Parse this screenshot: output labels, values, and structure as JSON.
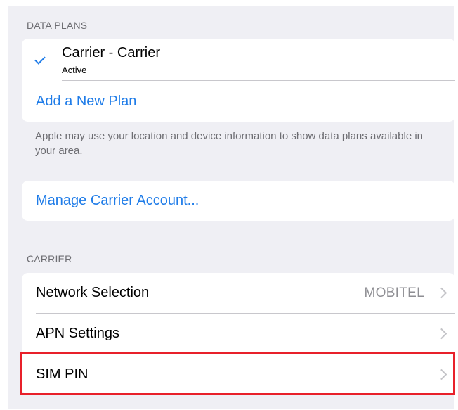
{
  "data_plans": {
    "header": "DATA PLANS",
    "plan_name": "Carrier - Carrier",
    "plan_status": "Active",
    "add_plan": "Add a New Plan",
    "footer": "Apple may use your location and device information to show data plans available in your area."
  },
  "manage": {
    "label": "Manage Carrier Account..."
  },
  "carrier": {
    "header": "CARRIER",
    "rows": [
      {
        "label": "Network Selection",
        "detail": "MOBITEL"
      },
      {
        "label": "APN Settings"
      },
      {
        "label": "SIM PIN"
      }
    ]
  },
  "colors": {
    "accent": "#1f7ce8",
    "highlight": "#e8202a",
    "background": "#efeff4"
  },
  "icons": [
    "checkmark-icon",
    "chevron-right-icon"
  ]
}
